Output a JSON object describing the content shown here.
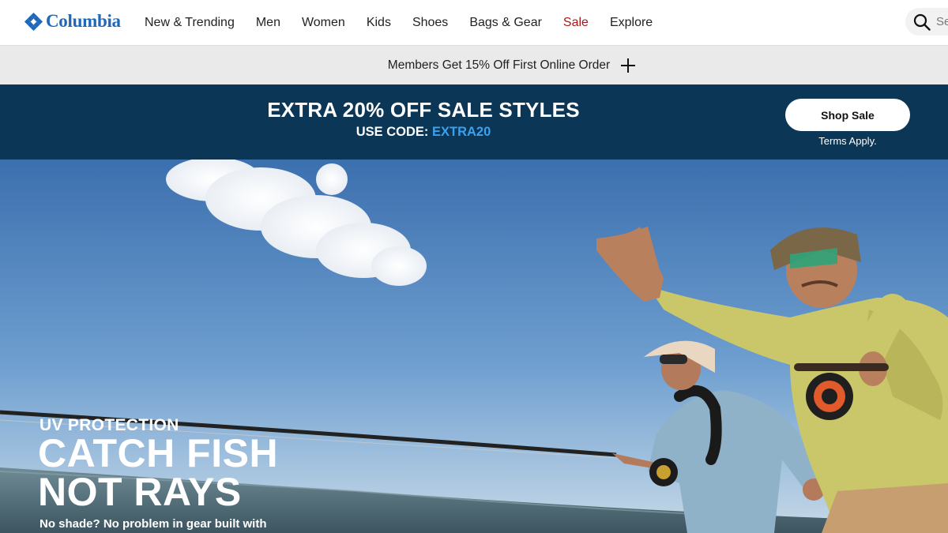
{
  "brand": {
    "name": "Columbia",
    "color": "#1f68b8"
  },
  "nav": {
    "items": [
      {
        "label": "New & Trending"
      },
      {
        "label": "Men"
      },
      {
        "label": "Women"
      },
      {
        "label": "Kids"
      },
      {
        "label": "Shoes"
      },
      {
        "label": "Bags & Gear"
      },
      {
        "label": "Sale"
      },
      {
        "label": "Explore"
      }
    ],
    "sale_color": "#a51b1b"
  },
  "search": {
    "placeholder": "Se",
    "icon": "search-icon"
  },
  "member_bar": {
    "text": "Members Get 15% Off First Online Order",
    "icon": "plus-icon"
  },
  "promo": {
    "headline": "EXTRA 20% OFF SALE STYLES",
    "code_prefix": "USE CODE: ",
    "code": "EXTRA20",
    "button_label": "Shop Sale",
    "terms": "Terms Apply.",
    "background": "#0b3656",
    "code_color": "#3aa2ee"
  },
  "hero": {
    "eyebrow": "UV PROTECTION",
    "title_line1": "CATCH FISH",
    "title_line2": "NOT RAYS",
    "body": "No shade? No problem in gear built with"
  }
}
